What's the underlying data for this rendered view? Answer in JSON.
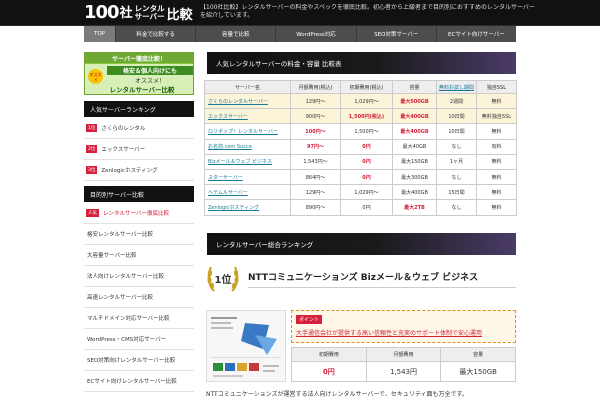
{
  "header": {
    "logo": {
      "num": "100",
      "sha": "社",
      "line1": "レンタル",
      "line2": "サーバー",
      "tail": "比較"
    },
    "description": "【100社比較】レンタルサーバーの料金やスペックを徹底比較。初心者から上級者まで目的別におすすめのレンタルサーバーを紹介しています。"
  },
  "nav": {
    "items": [
      {
        "label": "TOP",
        "active": true
      },
      {
        "label": "料金で比較する",
        "active": false
      },
      {
        "label": "容量で比較",
        "active": false
      },
      {
        "label": "WordPress対応",
        "active": false
      },
      {
        "label": "SEO対策サーバー",
        "active": false
      },
      {
        "label": "ECサイト向けサーバー",
        "active": false
      }
    ]
  },
  "sidebar": {
    "banner": {
      "top": "サーバー徹底比較！",
      "badge": "オススメ",
      "line1": "格安＆個人向けにも",
      "line2": "オススメ！",
      "line3": "レンタルサーバー比較"
    },
    "ranking_head": "人気サーバーランキング",
    "ranking": [
      {
        "tag": "1位",
        "label": "さくらのレンタル"
      },
      {
        "tag": "2位",
        "label": "エックスサーバー"
      },
      {
        "tag": "3位",
        "label": "Zenlogicホスティング"
      }
    ],
    "category_head": "目的別サーバー比較",
    "categories": [
      {
        "tag": "人気",
        "label": "レンタルサーバー徹底比較"
      },
      {
        "tag": "",
        "label": "格安レンタルサーバー比較"
      },
      {
        "tag": "",
        "label": "大容量サーバー比較"
      },
      {
        "tag": "",
        "label": "法人向けレンタルサーバー比較"
      },
      {
        "tag": "",
        "label": "高速レンタルサーバー比較"
      },
      {
        "tag": "",
        "label": "マルチドメイン対応サーバー比較"
      },
      {
        "tag": "",
        "label": "WordPress・CMS対応サーバー"
      },
      {
        "tag": "",
        "label": "SEO対策向けレンタルサーバー比較"
      },
      {
        "tag": "",
        "label": "ECサイト向けレンタルサーバー比較"
      }
    ]
  },
  "compare": {
    "title": "人気レンタルサーバーの料金・容量 比較表",
    "headers": [
      "サーバー名",
      "月額費用(税込)",
      "初期費用(税込)",
      "容量",
      "無料お試し期間",
      "独自SSL"
    ],
    "rows": [
      {
        "name": "さくらのレンタルサーバー",
        "monthly": "129円〜",
        "initial": "1,029円〜",
        "capacity": "最大500GB",
        "trial": "2週間",
        "ssl": "無料",
        "highlight": true,
        "monthly_red": false,
        "initial_red": false,
        "cap_red": true
      },
      {
        "name": "エックスサーバー",
        "monthly": "900円〜",
        "initial": "1,500円(税込)",
        "capacity": "最大400GB",
        "trial": "10日間",
        "ssl": "無料独自SSL",
        "highlight": true,
        "monthly_red": false,
        "initial_red": true,
        "cap_red": true
      },
      {
        "name": "ロリポップ！レンタルサーバー",
        "monthly": "100円〜",
        "initial": "1,500円〜",
        "capacity": "最大400GB",
        "trial": "10日間",
        "ssl": "無料",
        "highlight": false,
        "monthly_red": true,
        "initial_red": false,
        "cap_red": true
      },
      {
        "name": "お名前.com Succe",
        "monthly": "97円〜",
        "initial": "0円",
        "capacity": "最大40GB",
        "trial": "なし",
        "ssl": "有料",
        "highlight": false,
        "monthly_red": true,
        "initial_red": true,
        "cap_red": false
      },
      {
        "name": "Bizメール＆ウェブ ビジネス",
        "monthly": "1,543円〜",
        "initial": "0円",
        "capacity": "最大150GB",
        "trial": "1ヶ月",
        "ssl": "無料",
        "highlight": false,
        "monthly_red": false,
        "initial_red": true,
        "cap_red": false
      },
      {
        "name": "スターサーバー",
        "monthly": "864円〜",
        "initial": "0円",
        "capacity": "最大300GB",
        "trial": "なし",
        "ssl": "無料",
        "highlight": false,
        "monthly_red": false,
        "initial_red": true,
        "cap_red": false
      },
      {
        "name": "ヘテムルサーバー",
        "monthly": "129円〜",
        "initial": "1,029円〜",
        "capacity": "最大400GB",
        "trial": "15日間",
        "ssl": "無料",
        "highlight": false,
        "monthly_red": false,
        "initial_red": false,
        "cap_red": false
      },
      {
        "name": "Zenlogicホスティング",
        "monthly": "890円〜",
        "initial": "0円",
        "capacity": "最大2TB",
        "trial": "なし",
        "ssl": "無料",
        "highlight": false,
        "monthly_red": false,
        "initial_red": false,
        "cap_red": true
      }
    ]
  },
  "ranking_section": {
    "title": "レンタルサーバー総合ランキング",
    "rank_label": "1位",
    "server_title": "NTTコミュニケーションズ Bizメール＆ウェブ ビジネス",
    "feature_tag": "ポイント",
    "feature_text": "大手通信会社が提供する高い信頼性と充実のサポート体制で安心運用",
    "spec_headers": [
      "初期費用",
      "月額費用",
      "容量"
    ],
    "spec_values": [
      "0円",
      "1,543円",
      "最大150GB"
    ],
    "note": "NTTコミュニケーションズが運営する法人向けレンタルサーバーで、セキュリティ面も万全です。"
  },
  "colors": {
    "accent_red": "#d4213d",
    "link": "#1a7a9a",
    "highlight_row": "#fcf4d9",
    "banner_green": "#8cc63f"
  }
}
